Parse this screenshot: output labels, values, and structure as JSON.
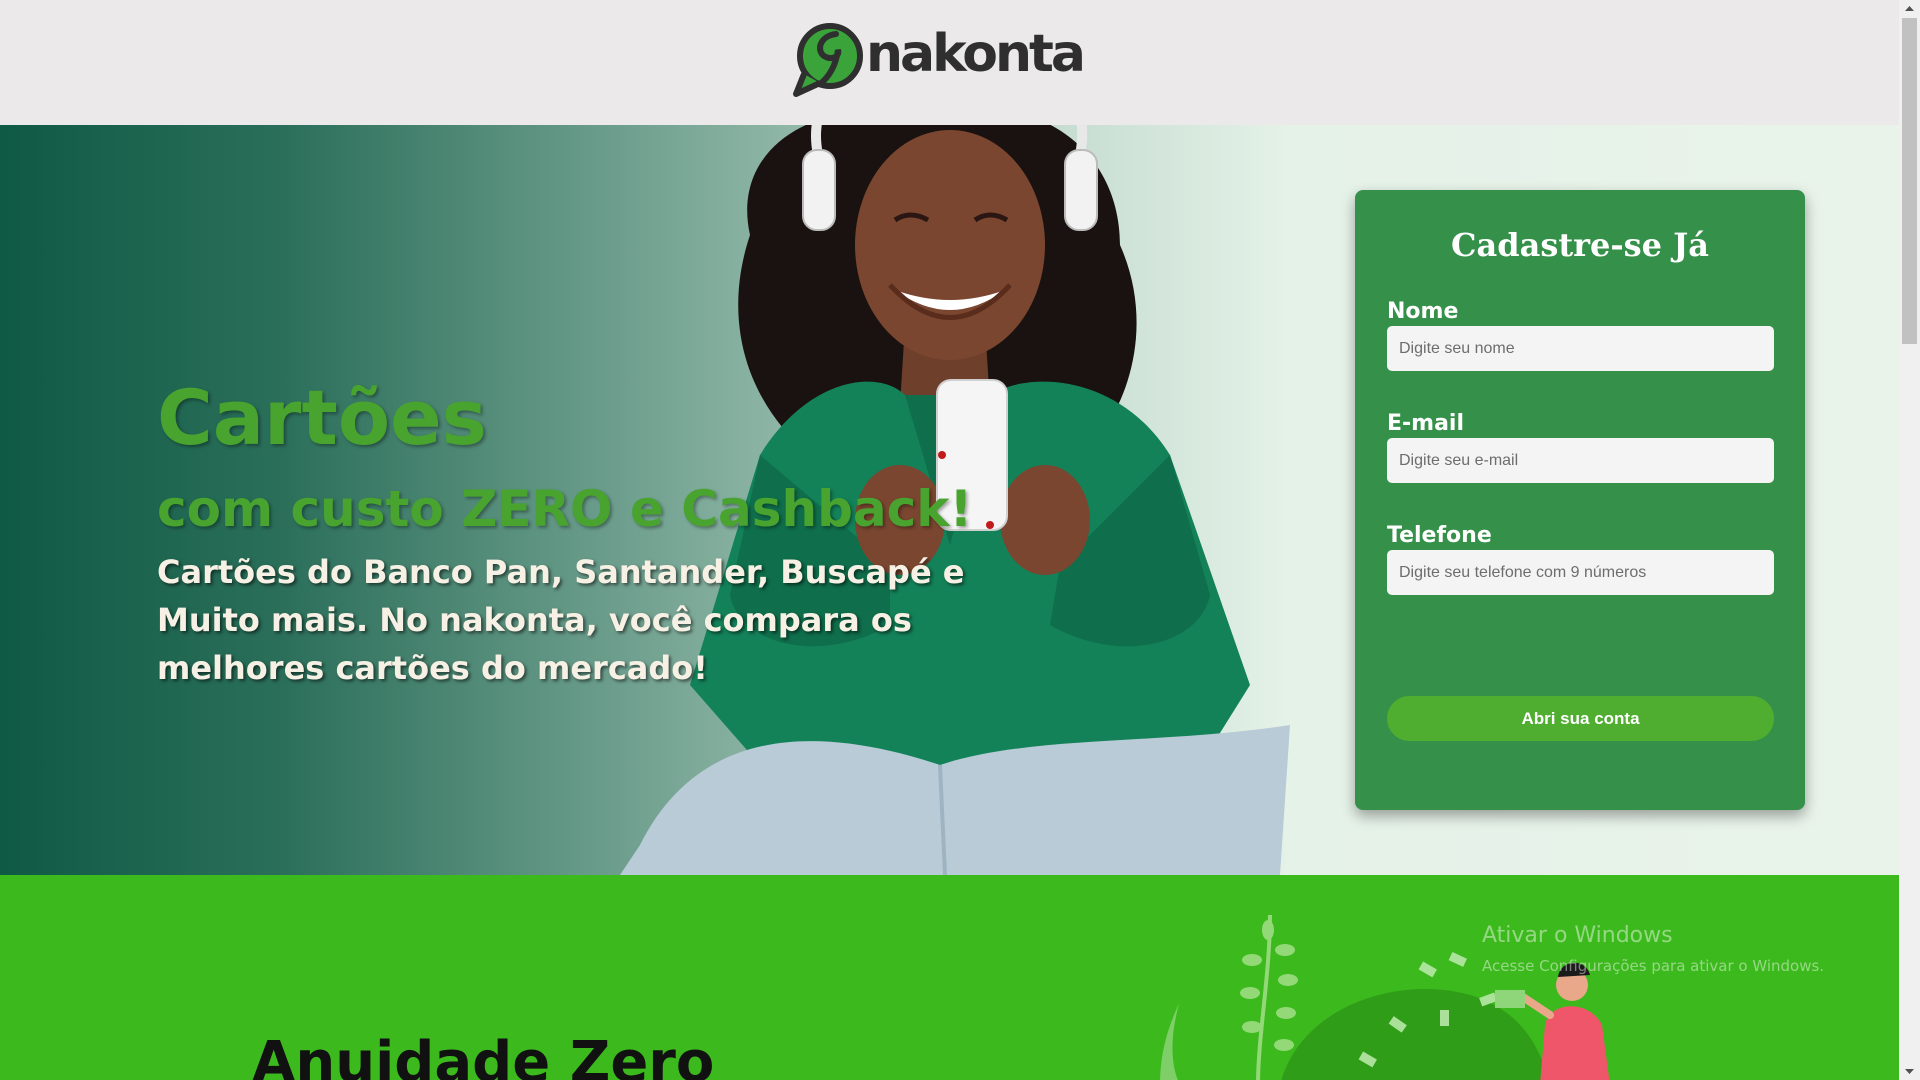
{
  "header": {
    "logo_text": "nakonta"
  },
  "hero": {
    "title": "Cartões",
    "subtitle": "com custo ZERO e Cashback!",
    "description": "Cartões do Banco Pan, Santander, Buscapé e Muito mais. No nakonta, você compara os melhores cartões do mercado!"
  },
  "form": {
    "title": "Cadastre-se Já",
    "name_label": "Nome",
    "name_placeholder": "Digite seu nome",
    "email_label": "E-mail",
    "email_placeholder": "Digite seu e-mail",
    "phone_label": "Telefone",
    "phone_placeholder": "Digite seu telefone com 9 números",
    "submit_label": "Abri sua conta"
  },
  "section2": {
    "title": "Anuidade Zero"
  },
  "watermark": {
    "title": "Ativar o Windows",
    "subtitle": "Acesse Configurações para ativar o Windows."
  },
  "colors": {
    "brand_green": "#48a32f",
    "card_green": "#35904a",
    "button_green": "#4fae30",
    "section_green": "#3cb91d",
    "hero_dark": "#0f5a44"
  },
  "icons": [
    "logo-bubble-icon",
    "scroll-up-arrow-icon",
    "scroll-down-arrow-icon"
  ]
}
